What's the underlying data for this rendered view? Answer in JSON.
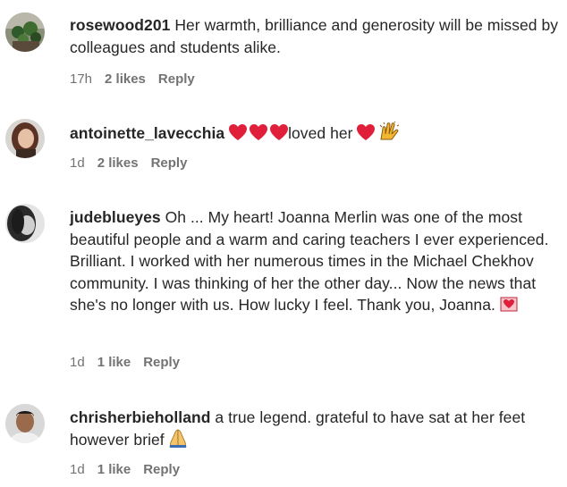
{
  "comments": [
    {
      "username": "rosewood201",
      "text": "Her warmth, brilliance and generosity will be missed by colleagues and students alike.",
      "time": "17h",
      "likes": "2 likes",
      "reply": "Reply",
      "avatar_icon": "avatar-plants"
    },
    {
      "username": "antoinette_lavecchia",
      "text_after_hearts": "loved her",
      "emojis": [
        "red-heart-icon",
        "red-heart-icon",
        "red-heart-icon",
        "red-heart-icon",
        "raising-hands-icon"
      ],
      "time": "1d",
      "likes": "2 likes",
      "reply": "Reply",
      "avatar_icon": "avatar-woman-brown-hair"
    },
    {
      "username": "judeblueyes",
      "text": "Oh ... My heart! Joanna Merlin was one of the most beautiful people and a warm and caring teachers I ever experienced. Brilliant. I worked with her numerous times in the Michael Chekhov community. I was thinking of her the other day... Now the news that she's no longer with us. How lucky I feel. Thank you, Joanna.",
      "emojis": [
        "heart-letter-icon"
      ],
      "time": "1d",
      "likes": "1 like",
      "reply": "Reply",
      "avatar_icon": "avatar-dark-hair-profile"
    },
    {
      "username": "chrisherbieholland",
      "text": "a true legend. grateful to have sat at her feet however brief",
      "emojis": [
        "folded-hands-icon"
      ],
      "time": "1d",
      "likes": "1 like",
      "reply": "Reply",
      "avatar_icon": "avatar-man-portrait"
    }
  ],
  "colors": {
    "text": "#262626",
    "meta": "#737373",
    "heart": "#e0203a"
  }
}
